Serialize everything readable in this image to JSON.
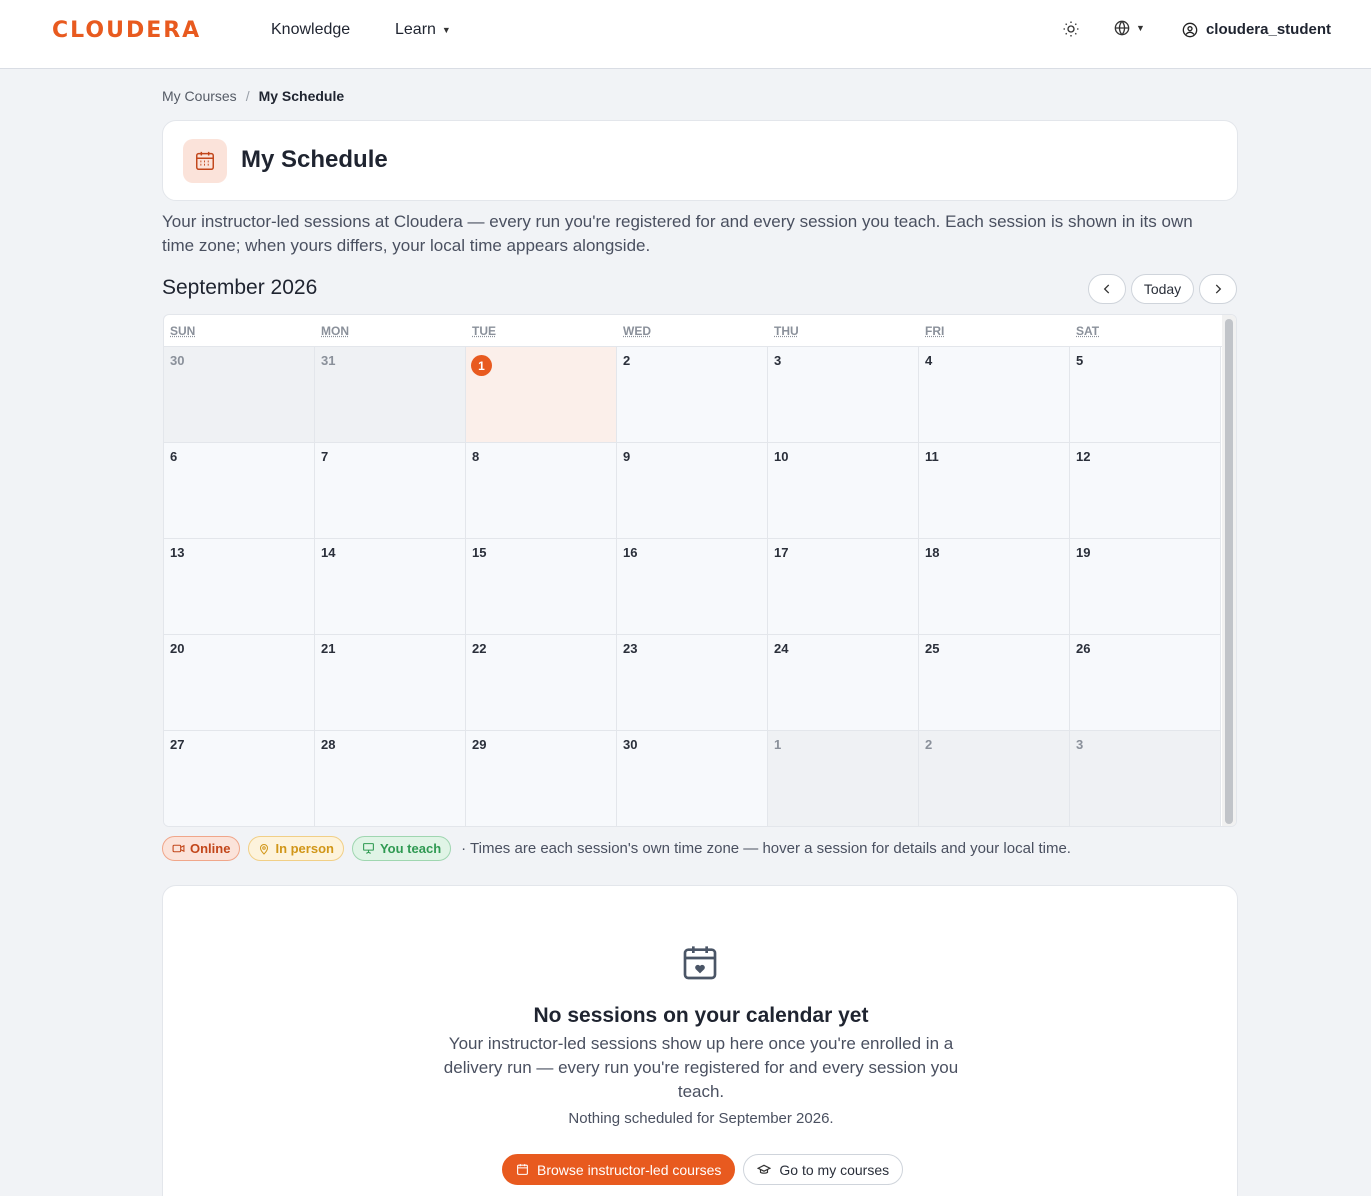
{
  "brand": {
    "logo_text": "CLOUDERA",
    "accent_color": "#e85a1f"
  },
  "nav": {
    "knowledge": "Knowledge",
    "learn": "Learn",
    "theme_icon": "sun-icon",
    "language_icon": "globe-icon",
    "user_icon": "user-circle-icon",
    "username": "cloudera_student"
  },
  "breadcrumb": {
    "parent": "My Courses",
    "separator": "/",
    "current": "My Schedule"
  },
  "header": {
    "title": "My Schedule",
    "icon": "calendar-icon"
  },
  "intro": "Your instructor-led sessions at Cloudera — every run you're registered for and every session you teach. Each session is shown in its own time zone; when yours differs, your local time appears alongside.",
  "calendar": {
    "month_label": "September 2026",
    "prev_icon": "chevron-left-icon",
    "today_label": "Today",
    "next_icon": "chevron-right-icon",
    "weekdays": [
      "SUN",
      "MON",
      "TUE",
      "WED",
      "THU",
      "FRI",
      "SAT"
    ],
    "weeks": [
      [
        {
          "d": "30",
          "other": true
        },
        {
          "d": "31",
          "other": true
        },
        {
          "d": "1",
          "today": true
        },
        {
          "d": "2"
        },
        {
          "d": "3"
        },
        {
          "d": "4"
        },
        {
          "d": "5"
        }
      ],
      [
        {
          "d": "6"
        },
        {
          "d": "7"
        },
        {
          "d": "8"
        },
        {
          "d": "9"
        },
        {
          "d": "10"
        },
        {
          "d": "11"
        },
        {
          "d": "12"
        }
      ],
      [
        {
          "d": "13"
        },
        {
          "d": "14"
        },
        {
          "d": "15"
        },
        {
          "d": "16"
        },
        {
          "d": "17"
        },
        {
          "d": "18"
        },
        {
          "d": "19"
        }
      ],
      [
        {
          "d": "20"
        },
        {
          "d": "21"
        },
        {
          "d": "22"
        },
        {
          "d": "23"
        },
        {
          "d": "24"
        },
        {
          "d": "25"
        },
        {
          "d": "26"
        }
      ],
      [
        {
          "d": "27"
        },
        {
          "d": "28"
        },
        {
          "d": "29"
        },
        {
          "d": "30"
        },
        {
          "d": "1",
          "other": true
        },
        {
          "d": "2",
          "other": true
        },
        {
          "d": "3",
          "other": true
        }
      ]
    ]
  },
  "legend": {
    "online": "Online",
    "in_person": "In person",
    "you_teach": "You teach",
    "note": "· Times are each session's own time zone — hover a session for details and your local time."
  },
  "empty_state": {
    "icon": "calendar-heart-icon",
    "title": "No sessions on your calendar yet",
    "body": "Your instructor-led sessions show up here once you're enrolled in a delivery run — every run you're registered for and every session you teach.",
    "sub": "Nothing scheduled for September 2026.",
    "primary_button": "Browse instructor-led courses",
    "secondary_button": "Go to my courses"
  }
}
